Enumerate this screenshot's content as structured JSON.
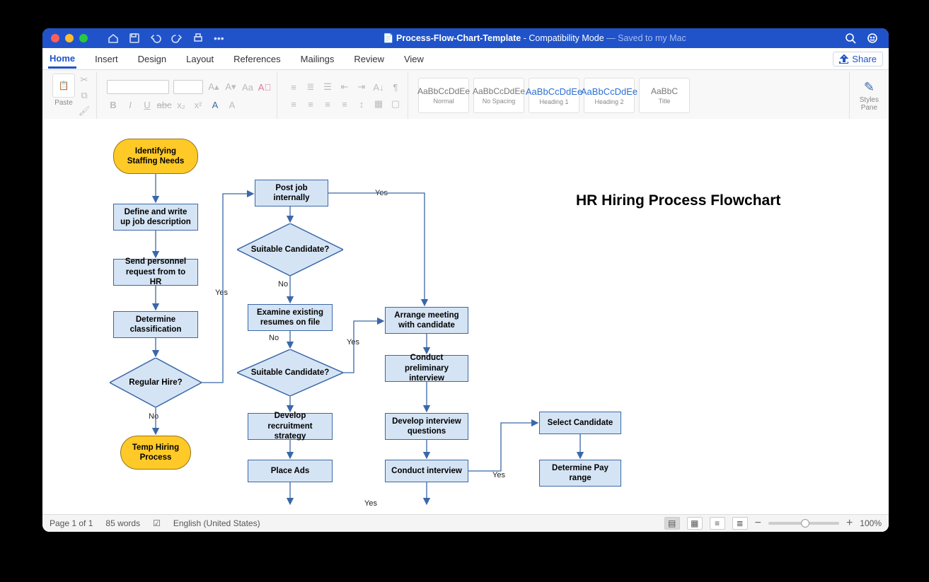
{
  "titlebar": {
    "filename": "Process-Flow-Chart-Template",
    "mode": "Compatibility Mode",
    "saved": "Saved to my Mac"
  },
  "tabs": [
    "Home",
    "Insert",
    "Design",
    "Layout",
    "References",
    "Mailings",
    "Review",
    "View"
  ],
  "share_label": "Share",
  "ribbon": {
    "paste": "Paste",
    "styles_pane": "Styles\nPane",
    "s1": {
      "sample": "AaBbCcDdEe",
      "label": "Normal"
    },
    "s2": {
      "sample": "AaBbCcDdEe",
      "label": "No Spacing"
    },
    "s3": {
      "sample": "AaBbCcDdEe",
      "label": "Heading 1"
    },
    "s4": {
      "sample": "AaBbCcDdEe",
      "label": "Heading 2"
    },
    "s5": {
      "sample": "AaBbC",
      "label": "Title"
    }
  },
  "status": {
    "page": "Page 1 of 1",
    "words": "85 words",
    "lang": "English (United States)",
    "zoom": "100%"
  },
  "flow": {
    "title": "HR Hiring Process Flowchart",
    "n1": "Identifying Staffing Needs",
    "n2": "Define and write up job description",
    "n3": "Send personnel request from to HR",
    "n4": "Determine classification",
    "n5": "Regular Hire?",
    "n6": "Temp Hiring Process",
    "n7": "Post job internally",
    "n8": "Suitable Candidate?",
    "n9": "Examine existing resumes on file",
    "n10": "Suitable Candidate?",
    "n11": "Develop recruitment strategy",
    "n12": "Place Ads",
    "n13": "Arrange meeting with candidate",
    "n14": "Conduct preliminary interview",
    "n15": "Develop interview questions",
    "n16": "Conduct interview",
    "n17": "Select Candidate",
    "n18": "Determine Pay range",
    "yes": "Yes",
    "no": "No"
  }
}
